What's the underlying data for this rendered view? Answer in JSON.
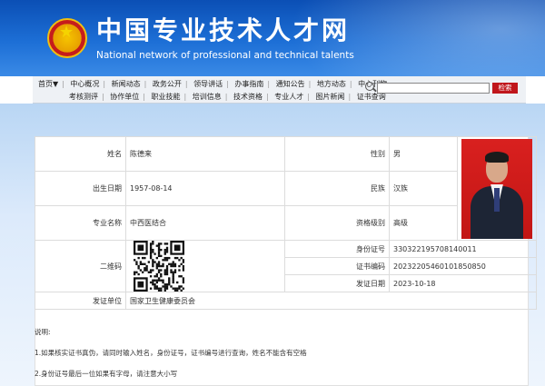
{
  "header": {
    "title_cn": "中国专业技术人才网",
    "title_en": "National network of professional and technical talents"
  },
  "nav": {
    "row1": [
      "首页▼",
      "中心概况",
      "新闻动态",
      "政务公开",
      "领导讲话",
      "办事指南",
      "通知公告",
      "地方动态",
      "中心刊物"
    ],
    "row2": [
      "考核测评",
      "协作单位",
      "职业技能",
      "培训信息",
      "技术资格",
      "专业人才",
      "图片新闻",
      "证书查询"
    ]
  },
  "search": {
    "placeholder": "",
    "button": "检索"
  },
  "record": {
    "name_label": "姓名",
    "name": "陈德来",
    "gender_label": "性别",
    "gender": "男",
    "birth_label": "出生日期",
    "birth": "1957-08-14",
    "ethnic_label": "民族",
    "ethnic": "汉族",
    "major_label": "专业名称",
    "major": "中西医结合",
    "level_label": "资格级别",
    "level": "高级",
    "qr_label": "二维码",
    "id_label": "身份证号",
    "id": "330322195708140011",
    "cert_label": "证书编码",
    "cert": "20232205460101850850",
    "date_label": "发证日期",
    "date": "2023-10-18",
    "issuer_label": "发证单位",
    "issuer": "国家卫生健康委员会"
  },
  "notes": {
    "title": "说明:",
    "item1": "1.如果核实证书真伪，请同时输入姓名，身份证号，证书编号进行查询，姓名不能含有空格",
    "item2": "2.身份证号最后一位如果有字母，请注意大小写"
  },
  "colors": {
    "banner": "#1d6fd6",
    "search_button": "#c0161b",
    "photo_bg": "#d9201f"
  }
}
